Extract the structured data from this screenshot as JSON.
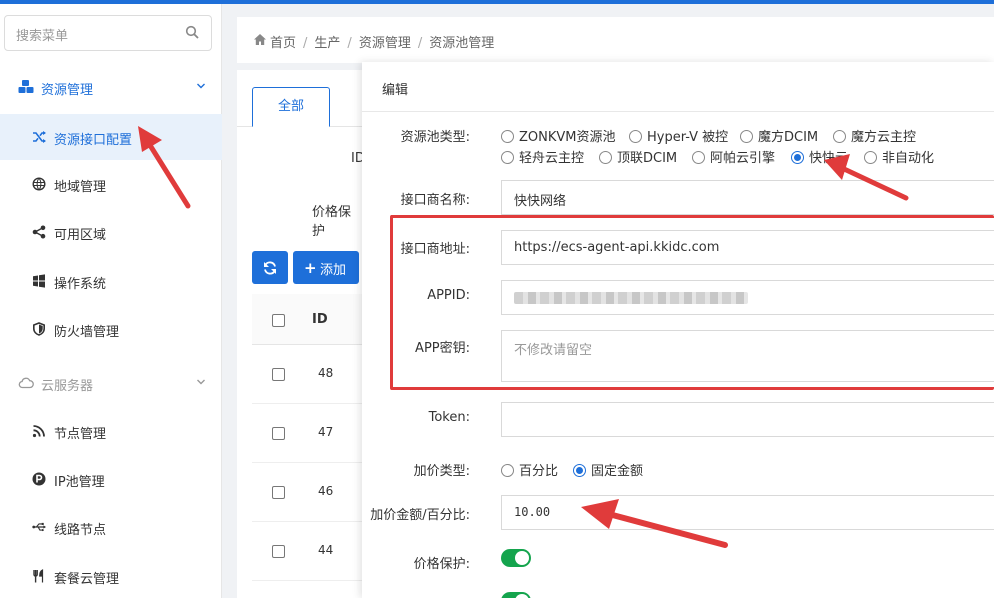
{
  "sidebar": {
    "search_placeholder": "搜索菜单",
    "group1": "资源管理",
    "items": [
      {
        "label": "资源接口配置"
      },
      {
        "label": "地域管理"
      },
      {
        "label": "可用区域"
      },
      {
        "label": "操作系统"
      },
      {
        "label": "防火墙管理"
      }
    ],
    "group2": "云服务器",
    "items2": [
      {
        "label": "节点管理"
      },
      {
        "label": "IP池管理"
      },
      {
        "label": "线路节点"
      },
      {
        "label": "套餐云管理"
      }
    ]
  },
  "breadcrumb": {
    "home": "首页",
    "b1": "生产",
    "b2": "资源管理",
    "b3": "资源池管理"
  },
  "list": {
    "tab_all": "全部",
    "filter_id": "ID",
    "filter_price": "价格保护",
    "add_label": "添加",
    "col_id": "ID",
    "rows": [
      "48",
      "47",
      "46",
      "44"
    ]
  },
  "modal": {
    "title": "编辑",
    "pool_type_label": "资源池类型:",
    "pool_types_row1": [
      "ZONKVM资源池",
      "Hyper-V 被控",
      "魔方DCIM",
      "魔方云主控"
    ],
    "pool_types_row2": [
      "轻舟云主控",
      "顶联DCIM",
      "阿帕云引擎",
      "快快云",
      "非自动化"
    ],
    "selected_pool_type": "快快云",
    "vendor_name_label": "接口商名称:",
    "vendor_name_value": "快快网络",
    "vendor_addr_label": "接口商地址:",
    "vendor_addr_value": "https://ecs-agent-api.kkidc.com",
    "appid_label": "APPID:",
    "appkey_label": "APP密钥:",
    "appkey_placeholder": "不修改请留空",
    "token_label": "Token:",
    "markup_type_label": "加价类型:",
    "markup_types": [
      "百分比",
      "固定金额"
    ],
    "selected_markup_type": "固定金额",
    "markup_amount_label": "加价金额/百分比:",
    "markup_amount_value": "10.00",
    "price_protect_label": "价格保护:",
    "price_protect_on": true
  },
  "colors": {
    "accent": "#1e6fd9",
    "annotation": "#e03b3b",
    "toggle_on": "#14a44d"
  }
}
